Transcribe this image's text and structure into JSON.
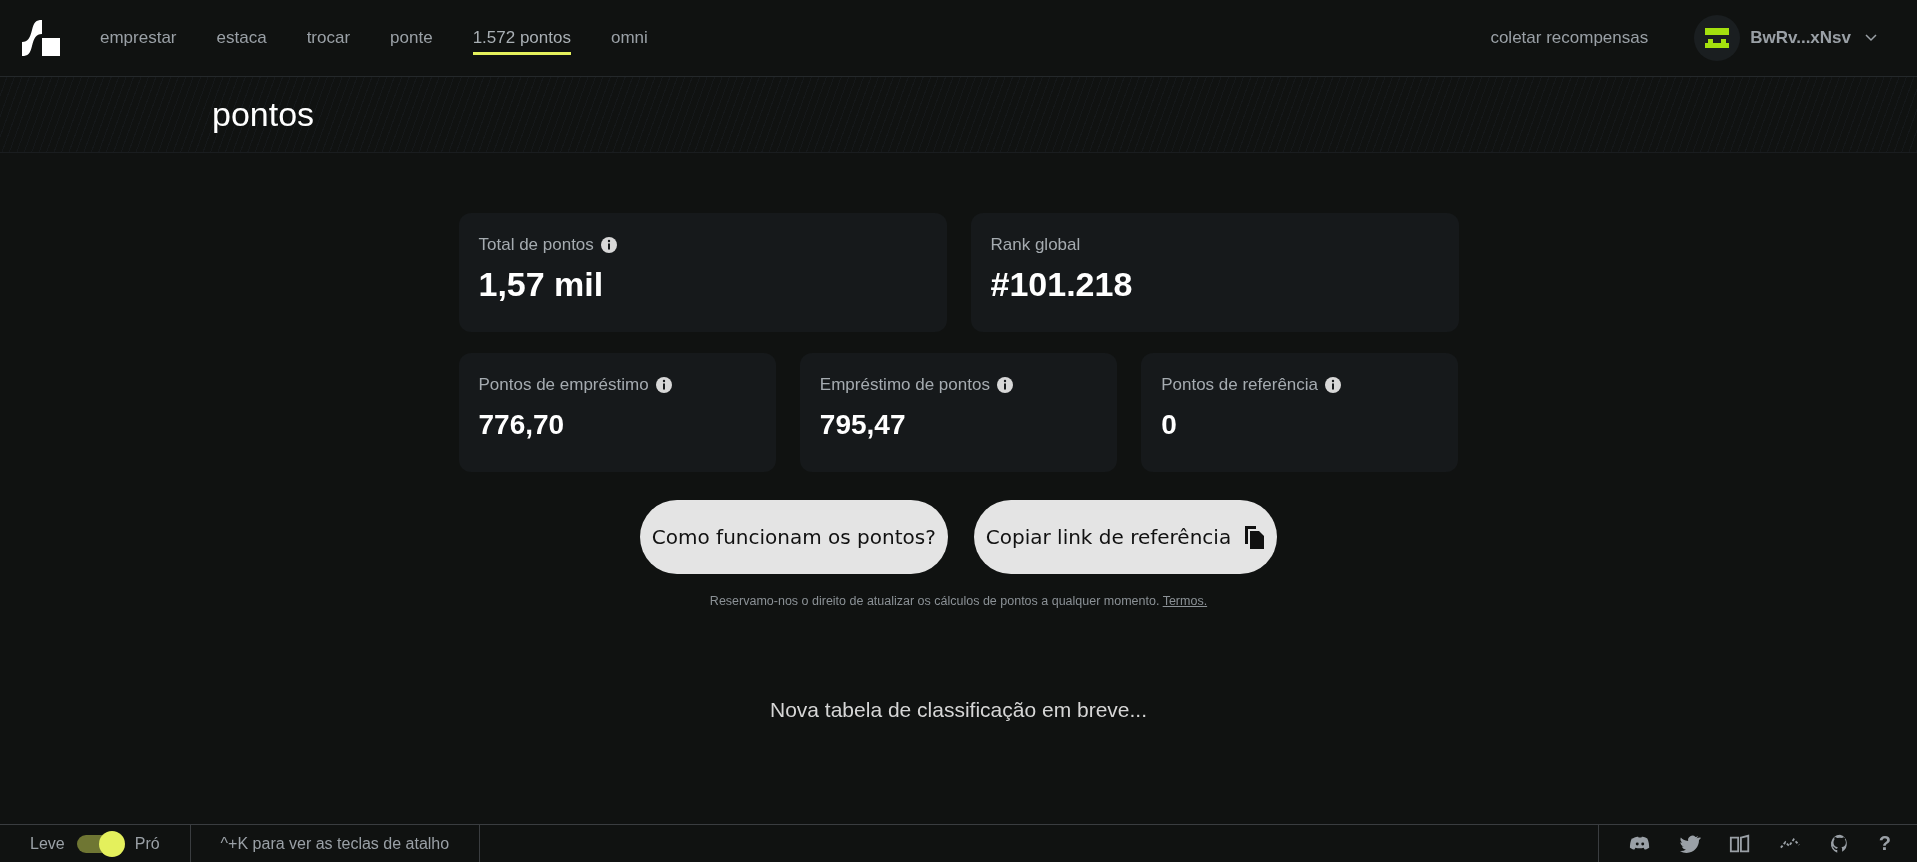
{
  "nav": {
    "items": [
      {
        "label": "emprestar",
        "selected": false
      },
      {
        "label": "estaca",
        "selected": false
      },
      {
        "label": "trocar",
        "selected": false
      },
      {
        "label": "ponte",
        "selected": false
      },
      {
        "label": "1.572 pontos",
        "selected": true
      },
      {
        "label": "omni",
        "selected": false
      }
    ],
    "rewards_link": "coletar recompensas",
    "wallet": "BwRv...xNsv"
  },
  "page_title": "pontos",
  "stats_top": [
    {
      "label": "Total de pontos",
      "info": true,
      "value": "1,57 mil"
    },
    {
      "label": "Rank global",
      "info": false,
      "value": "#101.218"
    }
  ],
  "stats_bottom": [
    {
      "label": "Pontos de empréstimo",
      "info": true,
      "value": "776,70"
    },
    {
      "label": "Empréstimo de pontos",
      "info": true,
      "value": "795,47"
    },
    {
      "label": "Pontos de referência",
      "info": true,
      "value": "0"
    }
  ],
  "buttons": [
    {
      "label": "Como funcionam os pontos?",
      "kind": "plain"
    },
    {
      "label": "Copiar link de referência",
      "kind": "copy"
    }
  ],
  "disclaimer": "Reservamo-nos o direito de atualizar os cálculos de pontos a qualquer momento.",
  "terms_link": "Termos.",
  "leaderboard_note": "Nova tabela de classificação em breve...",
  "footer": {
    "mode_left": "Leve",
    "mode_right": "Pró",
    "pro_mode_on": true,
    "shortcut_hint": "^+K para ver as teclas de atalho",
    "help": "?"
  }
}
